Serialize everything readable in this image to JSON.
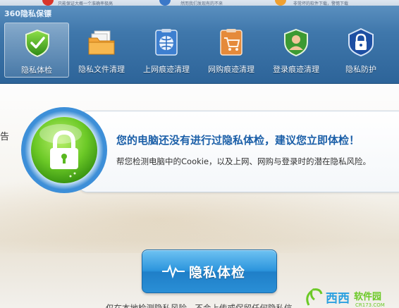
{
  "background_window": {
    "snippets": [
      "只能保证大概一个准确率极高",
      "然而我们发现有的不来",
      "非常坏的软件下载，警惕下载"
    ]
  },
  "app": {
    "title": "360隐私保镖"
  },
  "nav": {
    "items": [
      {
        "label": "隐私体检",
        "icon": "shield-check-icon",
        "active": true
      },
      {
        "label": "隐私文件清理",
        "icon": "folder-files-icon",
        "active": false
      },
      {
        "label": "上网痕迹清理",
        "icon": "globe-clipboard-icon",
        "active": false
      },
      {
        "label": "网购痕迹清理",
        "icon": "shopping-cart-clipboard-icon",
        "active": false
      },
      {
        "label": "登录痕迹清理",
        "icon": "user-shield-icon",
        "active": false
      },
      {
        "label": "隐私防护",
        "icon": "lock-shield-icon",
        "active": false
      }
    ]
  },
  "status": {
    "title": "您的电脑还没有进行过隐私体检，建议您立即体检！",
    "description": "帮您检测电脑中的Cookie，以及上网、网购与登录时的潜在隐私风险。",
    "edge_char": "告"
  },
  "scan_button": {
    "label": "隐私体检",
    "icon": "pulse-icon"
  },
  "footer": {
    "note": "仅在本地检测隐私风险，不会上传或保留任何隐私信"
  },
  "watermark": {
    "text_cn": "西西软件园",
    "text_en": "CR173.COM"
  },
  "colors": {
    "titlebar": "#3f77ab",
    "accent_blue": "#1b5fa8",
    "lock_green": "#6cc927",
    "button_blue": "#2c95dd"
  }
}
